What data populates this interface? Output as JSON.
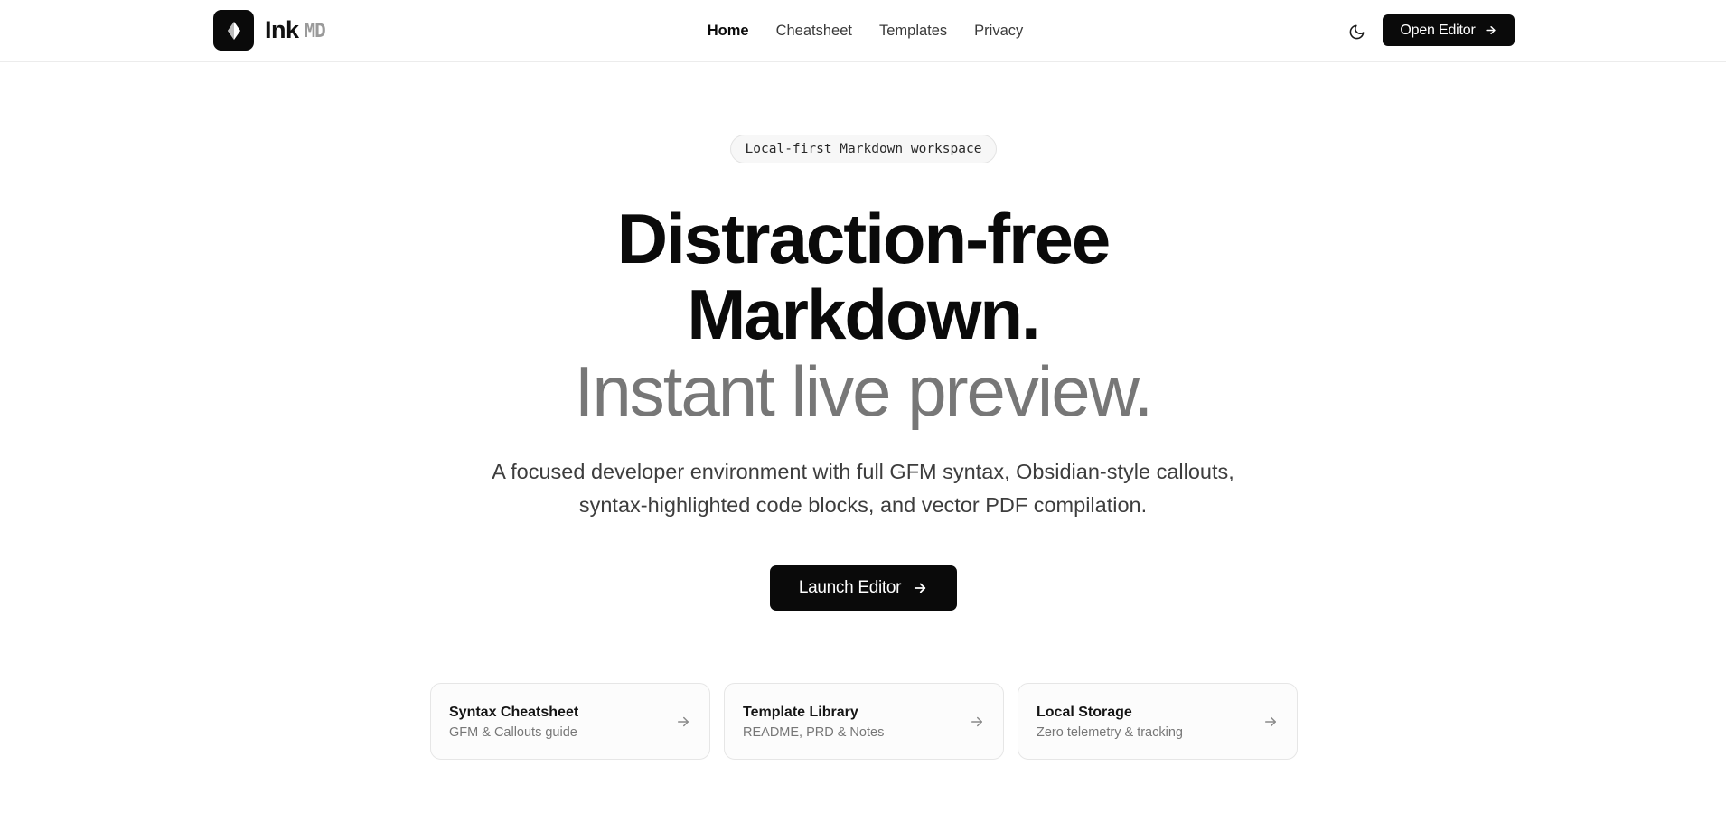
{
  "brand": {
    "name": "Ink",
    "suffix": "MD"
  },
  "nav": {
    "items": [
      {
        "label": "Home",
        "active": true
      },
      {
        "label": "Cheatsheet",
        "active": false
      },
      {
        "label": "Templates",
        "active": false
      },
      {
        "label": "Privacy",
        "active": false
      }
    ]
  },
  "header": {
    "theme_icon": "moon-icon",
    "open_editor_label": "Open Editor"
  },
  "hero": {
    "badge": "Local-first Markdown workspace",
    "headline_line1": "Distraction-free",
    "headline_line2": "Markdown.",
    "headline_sub": "Instant live preview.",
    "description_line1": "A focused developer environment with full GFM syntax, Obsidian-style callouts,",
    "description_line2": "syntax-highlighted code blocks, and vector PDF compilation.",
    "cta_label": "Launch Editor"
  },
  "cards": [
    {
      "title": "Syntax Cheatsheet",
      "subtitle": "GFM & Callouts guide"
    },
    {
      "title": "Template Library",
      "subtitle": "README, PRD & Notes"
    },
    {
      "title": "Local Storage",
      "subtitle": "Zero telemetry & tracking"
    }
  ],
  "colors": {
    "primary": "#0a0a0a",
    "muted_text": "#777777",
    "border": "#e6e6e6",
    "background": "#ffffff"
  }
}
